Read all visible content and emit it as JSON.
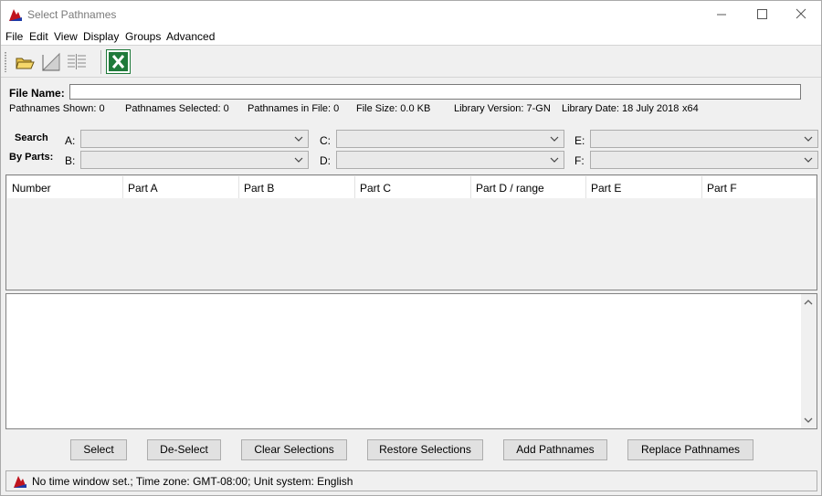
{
  "window": {
    "title": "Select Pathnames"
  },
  "menu": [
    "File",
    "Edit",
    "View",
    "Display",
    "Groups",
    "Advanced"
  ],
  "toolbar": {
    "icons": [
      "open-folder-icon",
      "graph-icon",
      "table-icon",
      "excel-icon"
    ]
  },
  "file": {
    "label": "File Name:",
    "value": ""
  },
  "info": {
    "shown": "Pathnames Shown:  0",
    "selected": "Pathnames Selected:  0",
    "in_file": "Pathnames in File:  0",
    "size": "File Size:  0.0  KB",
    "library_version": "Library Version: 7-GN",
    "library_date": "Library Date: 18 July 2018",
    "arch": "x64"
  },
  "search": {
    "label_line1": "Search",
    "label_line2": "By Parts:",
    "parts": {
      "a": {
        "label": "A:",
        "value": ""
      },
      "b": {
        "label": "B:",
        "value": ""
      },
      "c": {
        "label": "C:",
        "value": ""
      },
      "d": {
        "label": "D:",
        "value": ""
      },
      "e": {
        "label": "E:",
        "value": ""
      },
      "f": {
        "label": "F:",
        "value": ""
      }
    }
  },
  "table": {
    "columns": [
      "Number",
      "Part A",
      "Part B",
      "Part C",
      "Part D / range",
      "Part E",
      "Part F"
    ],
    "rows": []
  },
  "buttons": {
    "select": "Select",
    "deselect": "De-Select",
    "clear": "Clear Selections",
    "restore": "Restore Selections",
    "add": "Add Pathnames",
    "replace": "Replace Pathnames"
  },
  "status": {
    "text": "No time window set.;  Time zone: GMT-08:00;  Unit system: English"
  },
  "colors": {
    "accent_red": "#c0141e",
    "accent_blue": "#1c3aa8",
    "excel_green": "#1f7a3a"
  }
}
